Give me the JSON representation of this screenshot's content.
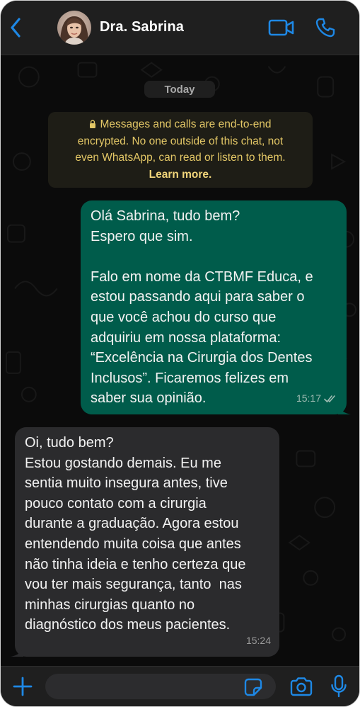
{
  "header": {
    "contact_name": "Dra. Sabrina"
  },
  "chat": {
    "date_label": "Today",
    "encryption": {
      "text_lines": [
        "Messages and calls are end-to-end",
        "encrypted. No one outside of this chat, not",
        "even WhatsApp, can read or listen to them."
      ],
      "learn_more": "Learn more."
    },
    "messages": [
      {
        "direction": "outgoing",
        "lines": [
          "Olá Sabrina, tudo bem?",
          "Espero que sim.",
          "",
          "Falo em nome da CTBMF Educa, e",
          "estou passando aqui para saber o",
          "que você achou do curso que",
          "adquiriu em nossa plataforma:",
          "“Excelência na Cirurgia dos Dentes",
          "Inclusos”. Ficaremos felizes em",
          "saber sua opinião."
        ],
        "time": "15:17",
        "status": "read"
      },
      {
        "direction": "incoming",
        "lines": [
          "Oi, tudo bem?",
          "Estou gostando demais. Eu me",
          "sentia muito insegura antes, tive",
          "pouco contato com a cirurgia",
          "durante a graduação. Agora estou",
          "entendendo muita coisa que antes",
          "não tinha ideia e tenho certeza que",
          "vou ter mais segurança, tanto  nas",
          "minhas cirurgias quanto no",
          "diagnóstico dos meus pacientes."
        ],
        "time": "15:24"
      }
    ]
  },
  "composer": {
    "input_value": "",
    "placeholder": ""
  },
  "icons": {
    "back": "chevron-left-icon",
    "video": "video-camera-icon",
    "call": "phone-icon",
    "plus": "plus-icon",
    "sticker": "sticker-icon",
    "camera": "camera-icon",
    "mic": "microphone-icon",
    "lock": "lock-icon",
    "read": "double-check-icon"
  },
  "colors": {
    "accent": "#1e88e5",
    "outgoing_bubble": "#005c4b",
    "incoming_bubble": "#2b2b2d",
    "encryption_text": "#e3c766"
  }
}
